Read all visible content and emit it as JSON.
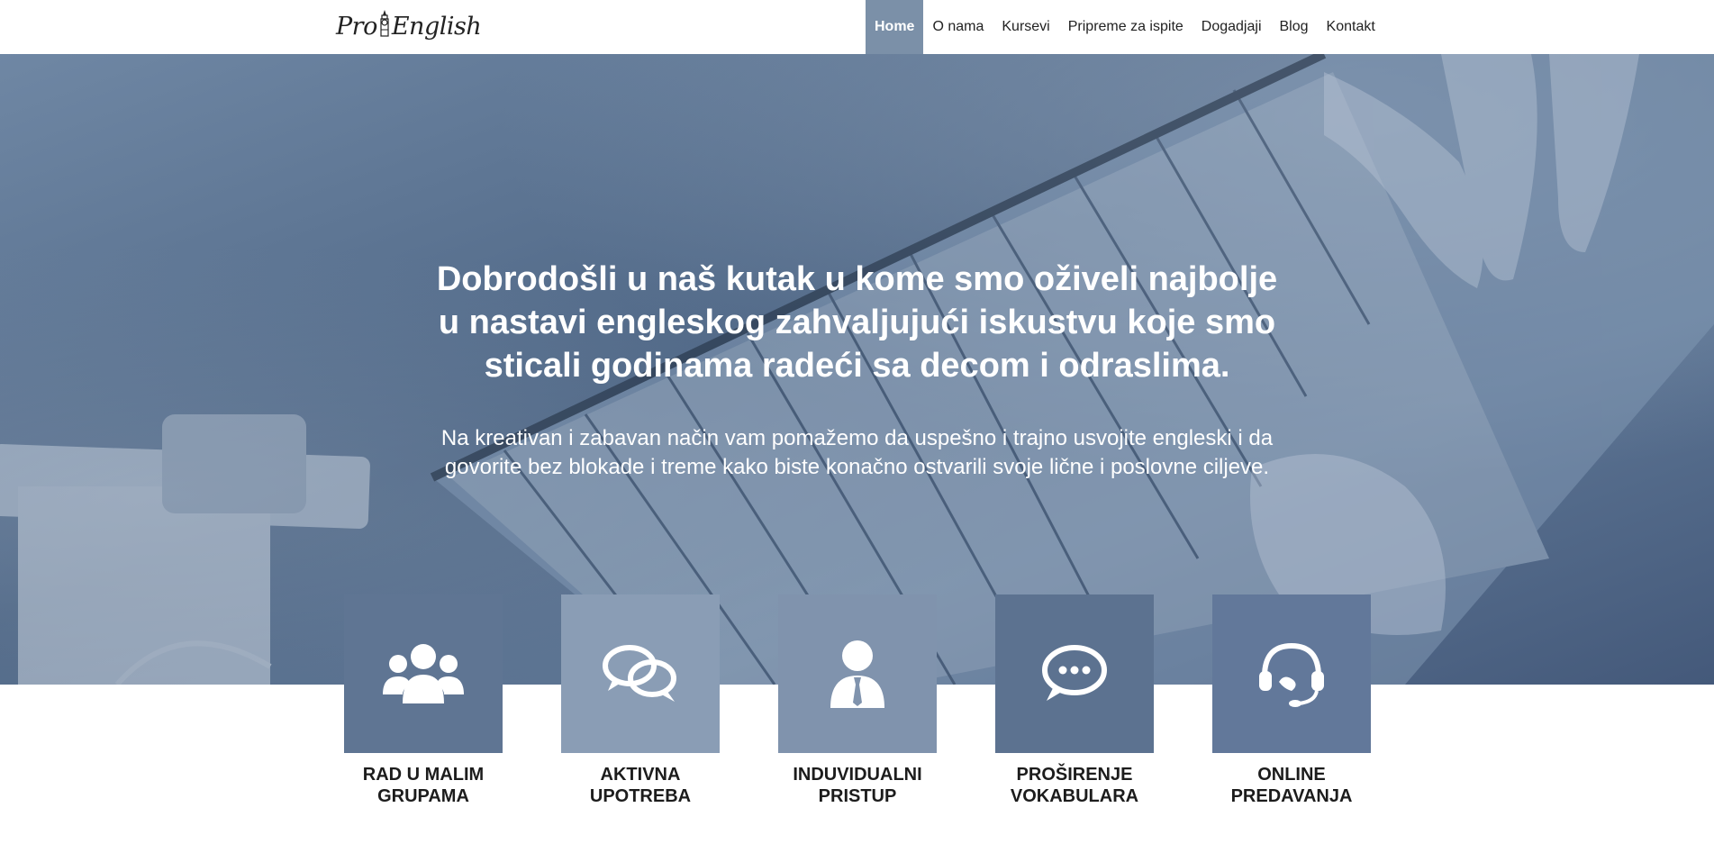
{
  "brand": {
    "logo_part1": "Pro",
    "logo_part2": "English",
    "logo_icon": "big-ben-icon"
  },
  "nav": {
    "items": [
      {
        "label": "Home",
        "active": true
      },
      {
        "label": "O nama",
        "active": false
      },
      {
        "label": "Kursevi",
        "active": false
      },
      {
        "label": "Pripreme za ispite",
        "active": false
      },
      {
        "label": "Dogadjaji",
        "active": false
      },
      {
        "label": "Blog",
        "active": false
      },
      {
        "label": "Kontakt",
        "active": false
      }
    ]
  },
  "hero": {
    "title": "Dobrodošli u naš kutak u kome smo oživeli najbolje u nastavi engleskog zahvaljujući iskustvu koje smo sticali godinama radeći sa decom i odraslima.",
    "subtitle": "Na kreativan i zabavan način vam pomažemo da uspešno i trajno usvojite engleski i da govorite bez blokade i treme kako biste konačno ostvarili svoje lične i poslovne ciljeve."
  },
  "features": [
    {
      "line1": "RAD U MALIM",
      "line2": "GRUPAMA",
      "icon": "group-icon",
      "color": "#5f7593"
    },
    {
      "line1": "AKTIVNA",
      "line2": "UPOTREBA",
      "icon": "chat-bubbles-icon",
      "color": "#8a9db5"
    },
    {
      "line1": "INDUVIDUALNI",
      "line2": "PRISTUP",
      "icon": "person-icon",
      "color": "#8093ad"
    },
    {
      "line1": "PROŠIRENJE",
      "line2": "VOKABULARA",
      "icon": "speech-bubble-icon",
      "color": "#5c7290"
    },
    {
      "line1": "ONLINE",
      "line2": "PREDAVANJA",
      "icon": "headset-icon",
      "color": "#62789a"
    }
  ],
  "colors": {
    "nav_active_bg": "#7b90a8",
    "hero_overlay": "#5a7090"
  }
}
